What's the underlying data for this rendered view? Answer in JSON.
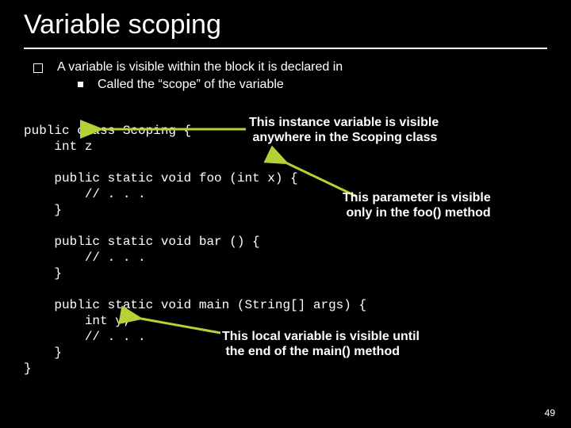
{
  "title": "Variable scoping",
  "bullets": {
    "level1": "A variable is visible within the block it is declared in",
    "level2": "Called the “scope” of the variable"
  },
  "code": {
    "l1": "public class Scoping {",
    "l2": "    int z",
    "l3": "",
    "l4": "    public static void foo (int x) {",
    "l5": "        // . . .",
    "l6": "    }",
    "l7": "",
    "l8": "    public static void bar () {",
    "l9": "        // . . .",
    "l10": "    }",
    "l11": "",
    "l12": "    public static void main (String[] args) {",
    "l13": "        int y;",
    "l14": "        // . . .",
    "l15": "    }",
    "l16": "}"
  },
  "annotations": {
    "a1": "This instance variable is visible\n anywhere in the Scoping class",
    "a2": "This parameter is visible\n only in the foo() method",
    "a3": "This local variable is visible until\n the end of the main() method"
  },
  "pagenum": "49",
  "arrow_color": "#b2d235"
}
